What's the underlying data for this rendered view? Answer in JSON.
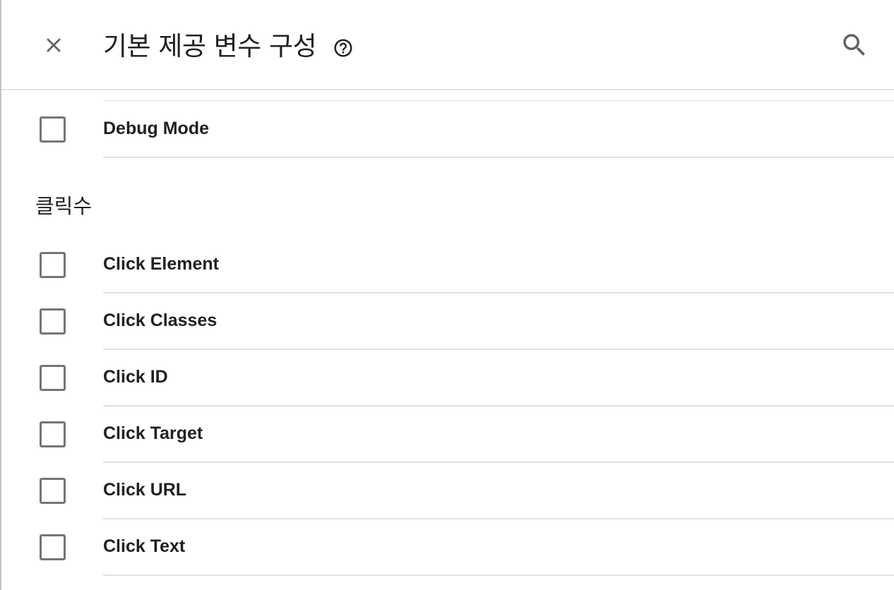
{
  "header": {
    "title": "기본 제공 변수 구성",
    "close_icon": "close-icon",
    "help_icon": "help-circle-icon",
    "search_icon": "search-icon"
  },
  "variables": {
    "top_items": [
      {
        "label": "Debug Mode",
        "checked": false
      }
    ],
    "clicks_section": {
      "heading": "클릭수",
      "items": [
        {
          "label": "Click Element",
          "checked": false
        },
        {
          "label": "Click Classes",
          "checked": false
        },
        {
          "label": "Click ID",
          "checked": false
        },
        {
          "label": "Click Target",
          "checked": false
        },
        {
          "label": "Click URL",
          "checked": false
        },
        {
          "label": "Click Text",
          "checked": false
        }
      ]
    }
  },
  "colors": {
    "text": "#202124",
    "checkbox_border": "#757575",
    "divider": "#e0e0e0",
    "icon": "#5f6368"
  }
}
